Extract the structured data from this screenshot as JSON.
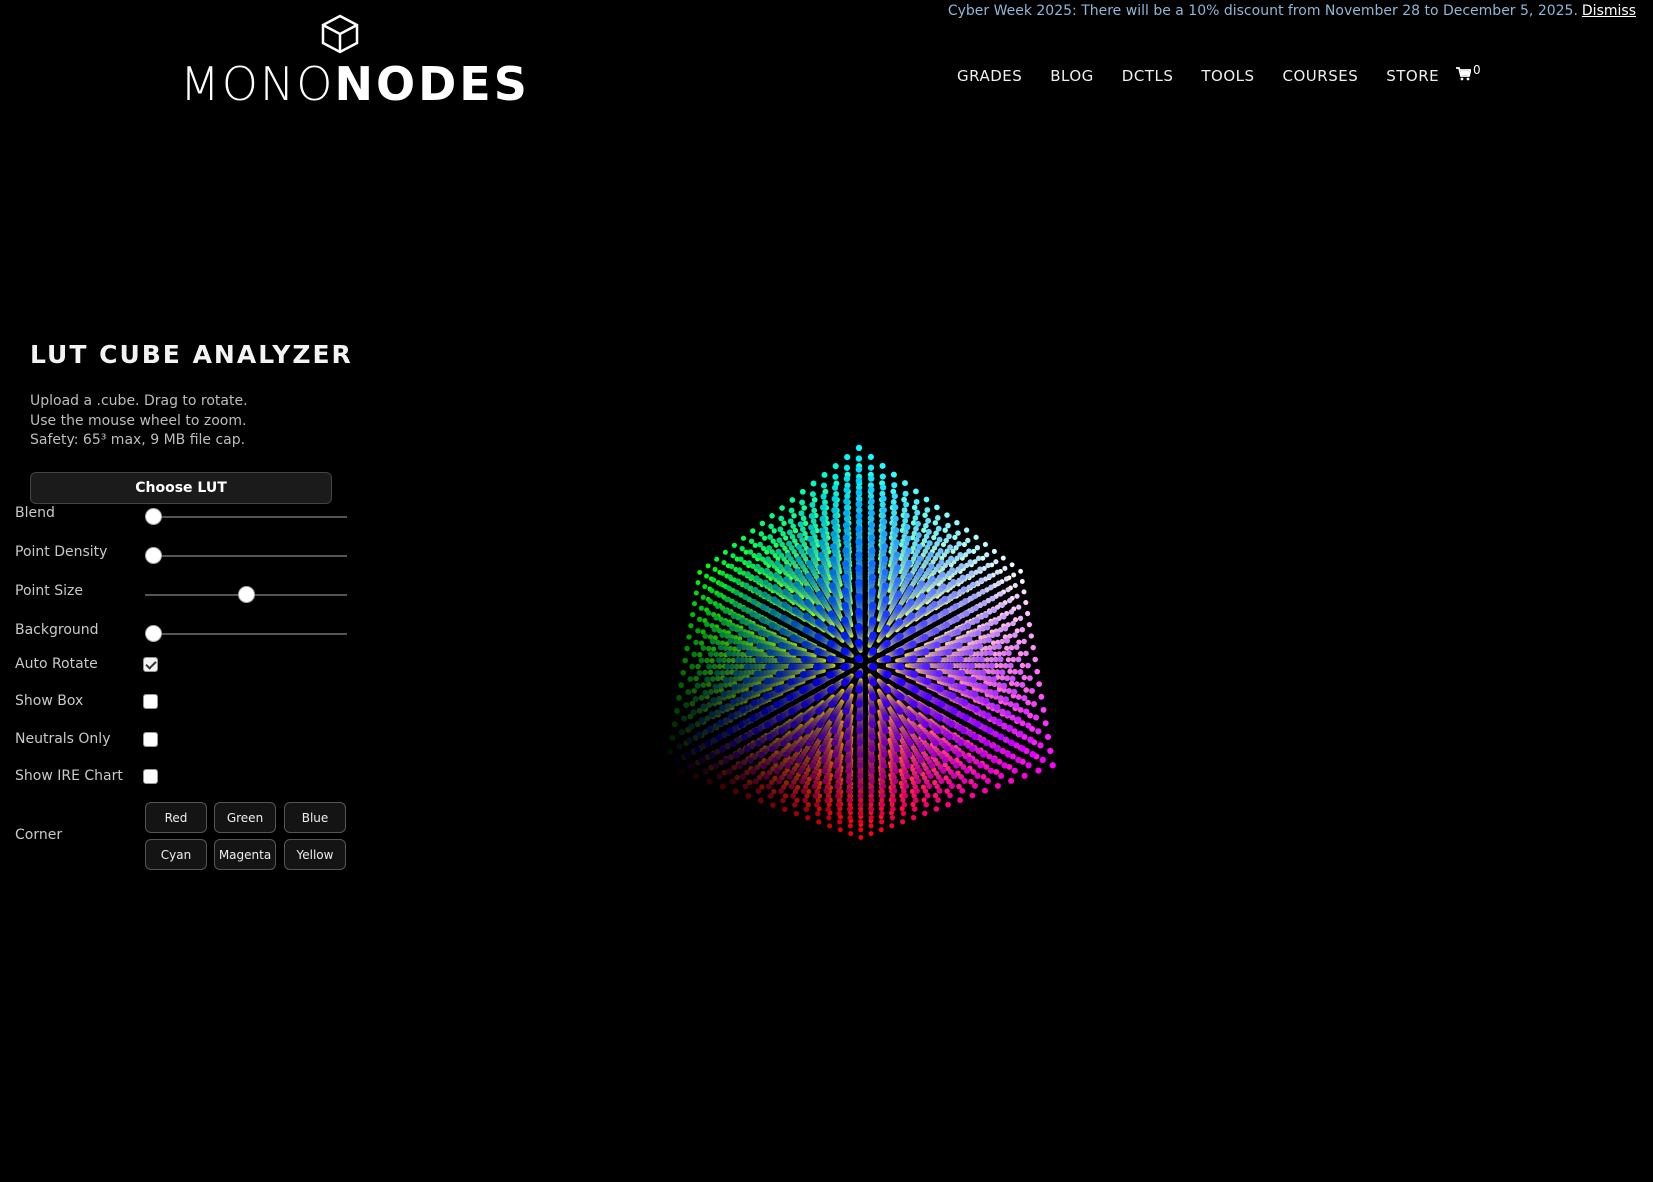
{
  "notice": {
    "text": "Cyber Week 2025: There will be a 10% discount from November 28 to December 5, 2025.",
    "dismiss_label": "Dismiss"
  },
  "logo": {
    "part1": "MONO",
    "part2": "NODES"
  },
  "nav": {
    "items": [
      "GRADES",
      "BLOG",
      "DCTLS",
      "TOOLS",
      "COURSES",
      "STORE"
    ],
    "cart_count": "0"
  },
  "panel": {
    "title": "LUT CUBE ANALYZER",
    "desc_lines": [
      "Upload a .cube. Drag to rotate.",
      "Use the mouse wheel to zoom.",
      "Safety: 65³ max, 9 MB file cap."
    ],
    "choose_label": "Choose LUT",
    "sliders": [
      {
        "label": "Blend",
        "value": 0.0
      },
      {
        "label": "Point Density",
        "value": 0.0
      },
      {
        "label": "Point Size",
        "value": 0.5
      },
      {
        "label": "Background",
        "value": 0.0
      }
    ],
    "checks": [
      {
        "label": "Auto Rotate",
        "checked": true
      },
      {
        "label": "Show Box",
        "checked": false
      },
      {
        "label": "Neutrals Only",
        "checked": false
      },
      {
        "label": "Show IRE Chart",
        "checked": false
      }
    ],
    "corner_label": "Corner",
    "corner_buttons": [
      "Red",
      "Green",
      "Blue",
      "Cyan",
      "Magenta",
      "Yellow"
    ]
  }
}
